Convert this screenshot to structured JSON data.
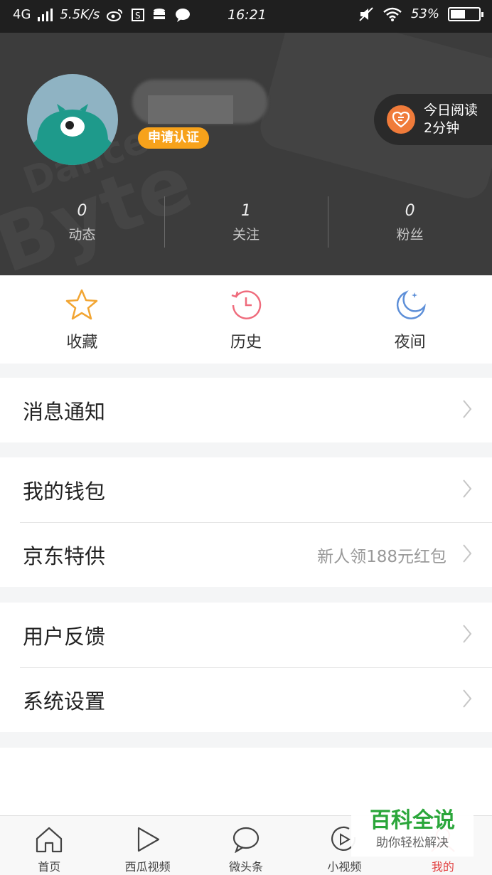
{
  "status_bar": {
    "network": "4G",
    "speed": "5.5K/s",
    "time": "16:21",
    "battery": "53%"
  },
  "profile": {
    "apply_label": "申请认证",
    "today_read_label": "今日阅读",
    "today_read_value": "2分钟",
    "stats": [
      {
        "value": "0",
        "label": "动态"
      },
      {
        "value": "1",
        "label": "关注"
      },
      {
        "value": "0",
        "label": "粉丝"
      }
    ]
  },
  "quick_actions": [
    {
      "label": "收藏",
      "icon": "star-icon"
    },
    {
      "label": "历史",
      "icon": "history-icon"
    },
    {
      "label": "夜间",
      "icon": "moon-icon"
    }
  ],
  "menu": {
    "notifications": "消息通知",
    "wallet": "我的钱包",
    "jd_offer": "京东特供",
    "jd_offer_sub": "新人领188元红包",
    "feedback": "用户反馈",
    "settings": "系统设置"
  },
  "tabs": [
    {
      "label": "首页",
      "icon": "home-icon"
    },
    {
      "label": "西瓜视频",
      "icon": "play-icon"
    },
    {
      "label": "微头条",
      "icon": "chat-bubble-icon"
    },
    {
      "label": "小视频",
      "icon": "small-video-icon"
    },
    {
      "label": "我的",
      "icon": "profile-icon",
      "active": true
    }
  ],
  "watermark": {
    "title": "百科全说",
    "subtitle": "助你轻松解决"
  },
  "colors": {
    "accent_orange": "#f7a21b",
    "header_bg": "#3c3c3c",
    "active_tab": "#e24242",
    "watermark_green": "#2aa63a"
  }
}
